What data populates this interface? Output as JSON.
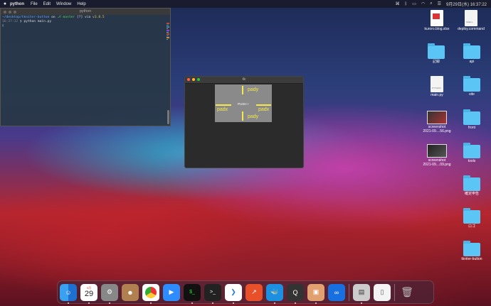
{
  "menubar": {
    "apple": "",
    "app_name": "python",
    "menus": [
      "File",
      "Edit",
      "Window",
      "Help"
    ],
    "clock": "9月29日(水) 16:37:22"
  },
  "terminal": {
    "title": "python",
    "lines": [
      {
        "path": "~/desktop/tkniter-button",
        "on": " on ",
        "branch": "master",
        "status": " [?] via ",
        "ver": "v3.8.5"
      },
      {
        "time": "16:37:12",
        "cmd": " ❯ python main.py"
      },
      {
        "cursor": "▯"
      }
    ]
  },
  "tk": {
    "title": "tk",
    "button_label": "PUSH !",
    "pady_top": "pady",
    "pady_bottom": "pady",
    "padx_left": "padx",
    "padx_right": "padx"
  },
  "desktop_icons": [
    {
      "label": "kuroro.blog.xlsx",
      "kind": "doc"
    },
    {
      "label": "deploy.command",
      "kind": "doc",
      "tag": "SHELL"
    },
    {
      "label": "記録",
      "kind": "folder"
    },
    {
      "label": "api",
      "kind": "folder"
    },
    {
      "label": "main.py",
      "kind": "doc",
      "tag": "PYTHON"
    },
    {
      "label": "site",
      "kind": "folder"
    },
    {
      "label": "screenshot\n2021-09....56.png",
      "kind": "shot"
    },
    {
      "label": "front",
      "kind": "folder"
    },
    {
      "label": "screenshot\n2021-09....09.png",
      "kind": "shot"
    },
    {
      "label": "tools",
      "kind": "folder"
    },
    {
      "label": "確定申告",
      "kind": "folder"
    },
    {
      "label": "ロゴ",
      "kind": "folder"
    },
    {
      "label": "tkniter-button",
      "kind": "folder"
    }
  ],
  "dock": {
    "calendar_month": "9月",
    "calendar_day": "29",
    "apps": [
      "Finder",
      "Calendar",
      "System Preferences",
      "Contacts",
      "Chrome",
      "Zoom",
      "iTerm",
      "Terminal",
      "VS Code",
      "Instruments",
      "Docker",
      "QuickTime",
      "Preview",
      "Infinity",
      "Photos",
      "Document",
      "Trash"
    ]
  }
}
